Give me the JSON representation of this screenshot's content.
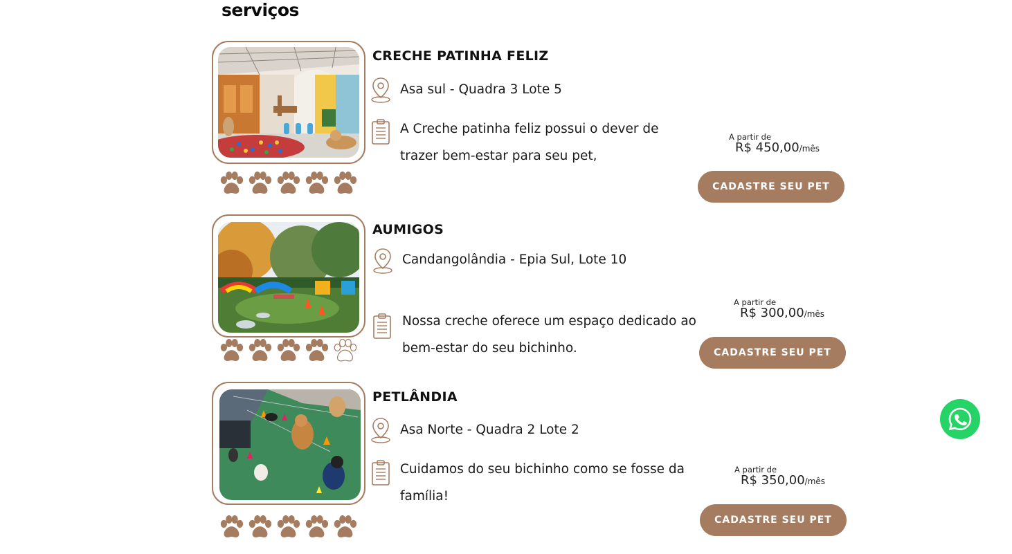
{
  "page": {
    "section_title": "serviços"
  },
  "colors": {
    "accent": "#a57c5f",
    "whatsapp": "#25d366"
  },
  "services": [
    {
      "name": "CRECHE PATINHA FELIZ",
      "address": "Asa sul - Quadra 3 Lote 5",
      "description": "A Creche patinha feliz possui o dever de trazer bem-estar para seu pet,",
      "price_from": "A partir de",
      "price": "R$ 450,00",
      "price_unit": "/mês",
      "cta": "CADASTRE SEU PET",
      "rating": 5,
      "rating_max": 5
    },
    {
      "name": "AUMIGOS",
      "address": "Candangolândia - Epia Sul, Lote 10",
      "description": "Nossa creche oferece um espaço dedicado ao bem-estar do seu bichinho.",
      "price_from": "A partir de",
      "price": "R$ 300,00",
      "price_unit": "/mês",
      "cta": "CADASTRE SEU PET",
      "rating": 4,
      "rating_max": 5
    },
    {
      "name": "PETLÂNDIA",
      "address": "Asa Norte - Quadra 2 Lote 2",
      "description": "Cuidamos do seu bichinho como se fosse da família!",
      "price_from": "A partir de",
      "price": "R$ 350,00",
      "price_unit": "/mês",
      "cta": "CADASTRE SEU PET",
      "rating": 5,
      "rating_max": 5
    }
  ],
  "icons": {
    "location": "map-pin-icon",
    "description": "clipboard-icon",
    "rating": "paw-icon",
    "chat": "whatsapp-icon"
  }
}
